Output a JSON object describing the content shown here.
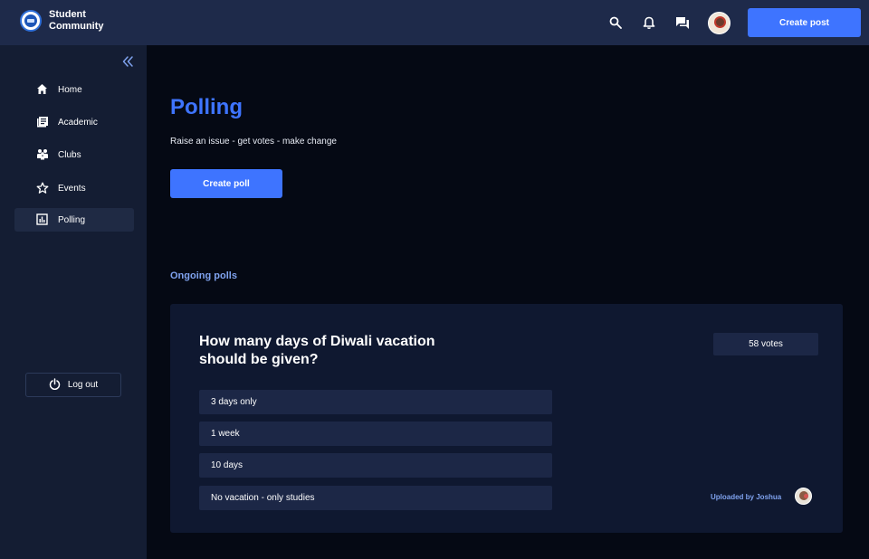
{
  "app": {
    "name": "Student Community"
  },
  "header": {
    "create_post_label": "Create post",
    "icons": [
      "search-icon",
      "bell-icon",
      "chat-icon"
    ]
  },
  "sidebar": {
    "items": [
      {
        "label": "Home",
        "icon": "home-icon"
      },
      {
        "label": "Academic",
        "icon": "academic-icon"
      },
      {
        "label": "Clubs",
        "icon": "clubs-icon"
      },
      {
        "label": "Events",
        "icon": "star-icon"
      },
      {
        "label": "Polling",
        "icon": "chart-icon",
        "active": true
      }
    ],
    "logout_label": "Log out"
  },
  "main": {
    "title": "Polling",
    "subtitle": "Raise an issue - get votes - make change",
    "create_poll_label": "Create poll",
    "section_title": "Ongoing polls",
    "poll": {
      "question": "How many days of Diwali vacation should be given?",
      "votes": "58 votes",
      "options": [
        "3 days only",
        "1 week",
        "10 days",
        "No vacation - only studies"
      ],
      "uploaded_by": "Uploaded by Joshua"
    }
  },
  "colors": {
    "accent": "#3e74ff",
    "topbar": "#1e2a4a",
    "sidebar": "#141d33",
    "background": "#050914",
    "card": "#0f1830",
    "option": "#1c2746",
    "link": "#7fa2ee"
  }
}
